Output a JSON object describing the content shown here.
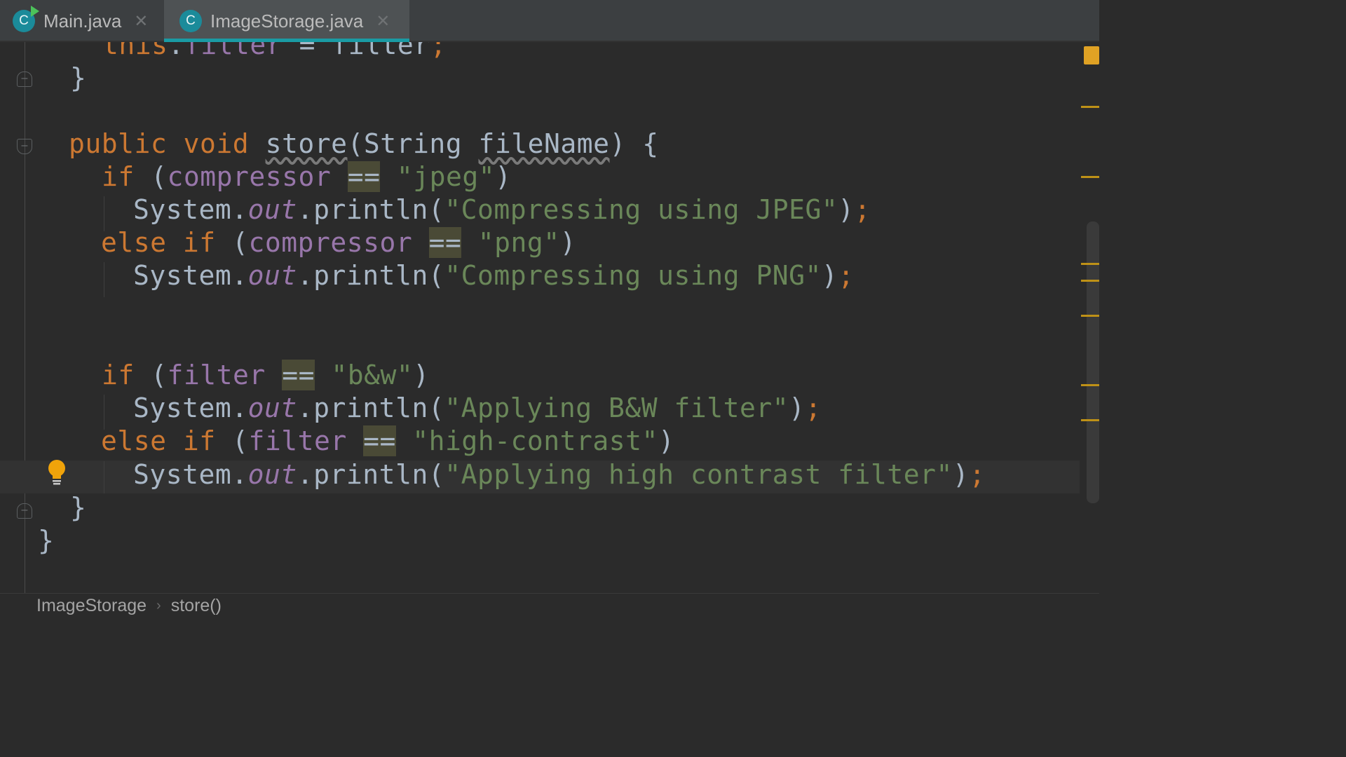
{
  "tabs": [
    {
      "name": "Main.java",
      "icon": "class-icon-C",
      "active": false
    },
    {
      "name": "ImageStorage.java",
      "icon": "class-icon-C",
      "active": true
    }
  ],
  "badge_letter": "C",
  "close_glyph": "✕",
  "code": {
    "l0": {
      "a": "this",
      "b": ".",
      "c": "filter",
      "d": " = ",
      "e": "filter",
      "f": ";"
    },
    "l1": {
      "brace": "}"
    },
    "l3": {
      "public": "public",
      "void": "void",
      "method": "store",
      "p1": "(String ",
      "param": "fileName",
      "p2": ") {"
    },
    "l4": {
      "if": "if",
      "p1": " (",
      "field": "compressor",
      "eq": "==",
      "str": "\"jpeg\"",
      "p2": ")"
    },
    "l5": {
      "sys": "System.",
      "out": "out",
      "call": ".println(",
      "str": "\"Compressing using JPEG\"",
      "close": ")",
      "semi": ";"
    },
    "l6": {
      "else": "else",
      "if": "if",
      "p1": " (",
      "field": "compressor",
      "eq": "==",
      "str": "\"png\"",
      "p2": ")"
    },
    "l7": {
      "sys": "System.",
      "out": "out",
      "call": ".println(",
      "str": "\"Compressing using PNG\"",
      "close": ")",
      "semi": ";"
    },
    "l10": {
      "if": "if",
      "p1": " (",
      "field": "filter",
      "eq": "==",
      "str": "\"b&w\"",
      "p2": ")"
    },
    "l11": {
      "sys": "System.",
      "out": "out",
      "call": ".println(",
      "str": "\"Applying B&W filter\"",
      "close": ")",
      "semi": ";"
    },
    "l12": {
      "else": "else",
      "if": "if",
      "p1": " (",
      "field": "filter",
      "eq": "==",
      "str": "\"high-contrast\"",
      "p2": ")"
    },
    "l13": {
      "sys": "System.",
      "out": "out",
      "call": ".println(",
      "str": "\"Applying high contrast filter\"",
      "close": ")",
      "semi": ";"
    },
    "l14": {
      "brace": "}"
    },
    "l15": {
      "brace": "}"
    }
  },
  "breadcrumb": {
    "class": "ImageStorage",
    "method": "store()",
    "sep": "›"
  },
  "colors": {
    "keyword": "#cc7832",
    "field": "#9876aa",
    "string": "#6a8759",
    "text": "#a9b7c6",
    "accent": "#1a9ba4"
  }
}
